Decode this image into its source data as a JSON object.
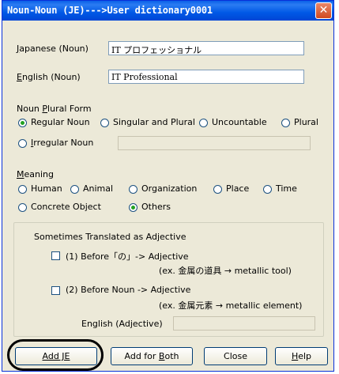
{
  "window": {
    "title": "Noun-Noun (JE)--->User dictionary0001",
    "close_glyph": "✕"
  },
  "japanese_noun": {
    "label_accel": "J",
    "label_rest": "apanese (Noun)",
    "value": "IT プロフェッショナル"
  },
  "english_noun": {
    "label_accel": "E",
    "label_rest": "nglish (Noun)",
    "value": "IT Professional"
  },
  "plural_form": {
    "label_pre": "Noun ",
    "label_accel": "P",
    "label_rest": "lural Form",
    "options": [
      "Regular Noun",
      "Singular and Plural",
      "Uncountable",
      "Plural"
    ],
    "irregular_accel": "I",
    "irregular_rest": "rregular Noun",
    "irregular_value": "",
    "selected": "Regular Noun"
  },
  "meaning": {
    "label_accel": "M",
    "label_rest": "eaning",
    "options": [
      "Human",
      "Animal",
      "Organization",
      "Place",
      "Time",
      "Concrete Object",
      "Others"
    ],
    "selected": "Others"
  },
  "adjective_group": {
    "title": "Sometimes Translated as Adjective",
    "option1": {
      "label": "(1) Before「の」-> Adjective",
      "example": "(ex. 金属の道具 → metallic tool)",
      "checked": false
    },
    "option2": {
      "label": "(2) Before Noun  -> Adjective",
      "example": "(ex. 金属元素 → metallic element)",
      "checked": false
    },
    "english_adj_label": "English (Adjective)",
    "english_adj_value": ""
  },
  "buttons": {
    "add_je": "Add JE",
    "add_both_pre": "Add for ",
    "add_both_accel": "B",
    "add_both_rest": "oth",
    "close": "Close",
    "help_accel": "H",
    "help_rest": "elp"
  },
  "colors": {
    "title_bar": "#0058e6",
    "dialog_bg": "#ece9d8",
    "radio_dot": "#21a121",
    "close_button": "#d24a1f"
  }
}
